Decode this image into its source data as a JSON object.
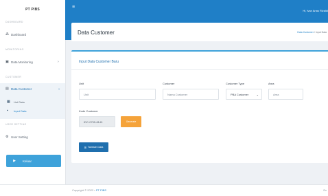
{
  "sidebar": {
    "brand": "PT PIBS",
    "sections": {
      "dashboard": "DASHBOARD",
      "monitoring": "MONITORING",
      "customer": "CUSTOMER",
      "user_setting": "USER SETTING"
    },
    "items": {
      "dashboard": "Dashboard",
      "data_monitoring": "Data Monitoring",
      "data_customer": "Data Customer",
      "user_setting": "User Setting"
    },
    "sub_items": {
      "list_data": "List Data",
      "input_data": "Input Data"
    },
    "logout": "Keluar"
  },
  "topbar": {
    "greeting": "Hi, Ivan Anas Rizaldi"
  },
  "header": {
    "title": "Data Customer",
    "breadcrumb": {
      "parent": "Data Customer",
      "separator": "/",
      "current": "Input Data"
    }
  },
  "form": {
    "title": "Input Data Customer Baru",
    "unit": {
      "label": "Unit",
      "value": "Unit"
    },
    "customer": {
      "label": "Customer",
      "placeholder": "Nama Customer"
    },
    "customer_type": {
      "label": "Customer Type",
      "value": "PBA Customer"
    },
    "area": {
      "label": "Area",
      "placeholder": "Area"
    },
    "kode": {
      "label": "Kode Customer",
      "value": "IDC-0795-8140"
    },
    "generate_button": "Generate",
    "add_button": "Tambah Data"
  },
  "footer": {
    "copyright": "Copyright © 2022 •",
    "company": "PT PIBS",
    "right_text": "Ez"
  },
  "colors": {
    "primary": "#1f7fc7",
    "accent_orange": "#f5a33a",
    "logout_blue": "#3ea2da"
  },
  "icons": {
    "menu": "hamburger-icon",
    "dashboard": "dashboard-icon",
    "monitoring": "monitor-icon",
    "customer": "user-list-icon",
    "list": "list-icon",
    "input": "input-icon",
    "setting": "gear-icon",
    "logout": "logout-icon"
  }
}
